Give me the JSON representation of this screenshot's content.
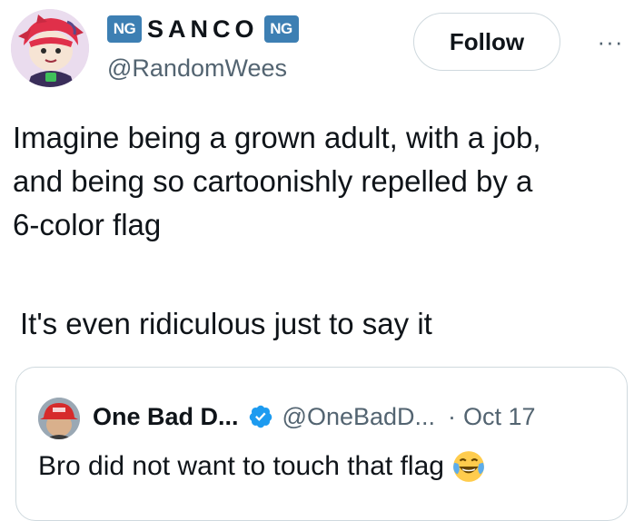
{
  "author": {
    "badge_left": "NG",
    "display_name": "SANCO",
    "badge_right": "NG",
    "handle": "@RandomWees"
  },
  "actions": {
    "follow_label": "Follow",
    "more_label": "···"
  },
  "tweet": {
    "text": "Imagine being a grown adult, with a job,\nand being so cartoonishly repelled by a\n6-color flag",
    "text_2": "It's even ridiculous just to say it"
  },
  "quote": {
    "name": "One Bad D...",
    "handle": "@OneBadD...",
    "separator": "·",
    "date": "Oct 17",
    "text": "Bro did not want to touch that flag",
    "emoji": "face-with-tears-of-joy"
  },
  "colors": {
    "badge": "#3d7fb3",
    "verified": "#1d9bf0",
    "secondary_text": "#536471",
    "border": "#cfd9de"
  }
}
